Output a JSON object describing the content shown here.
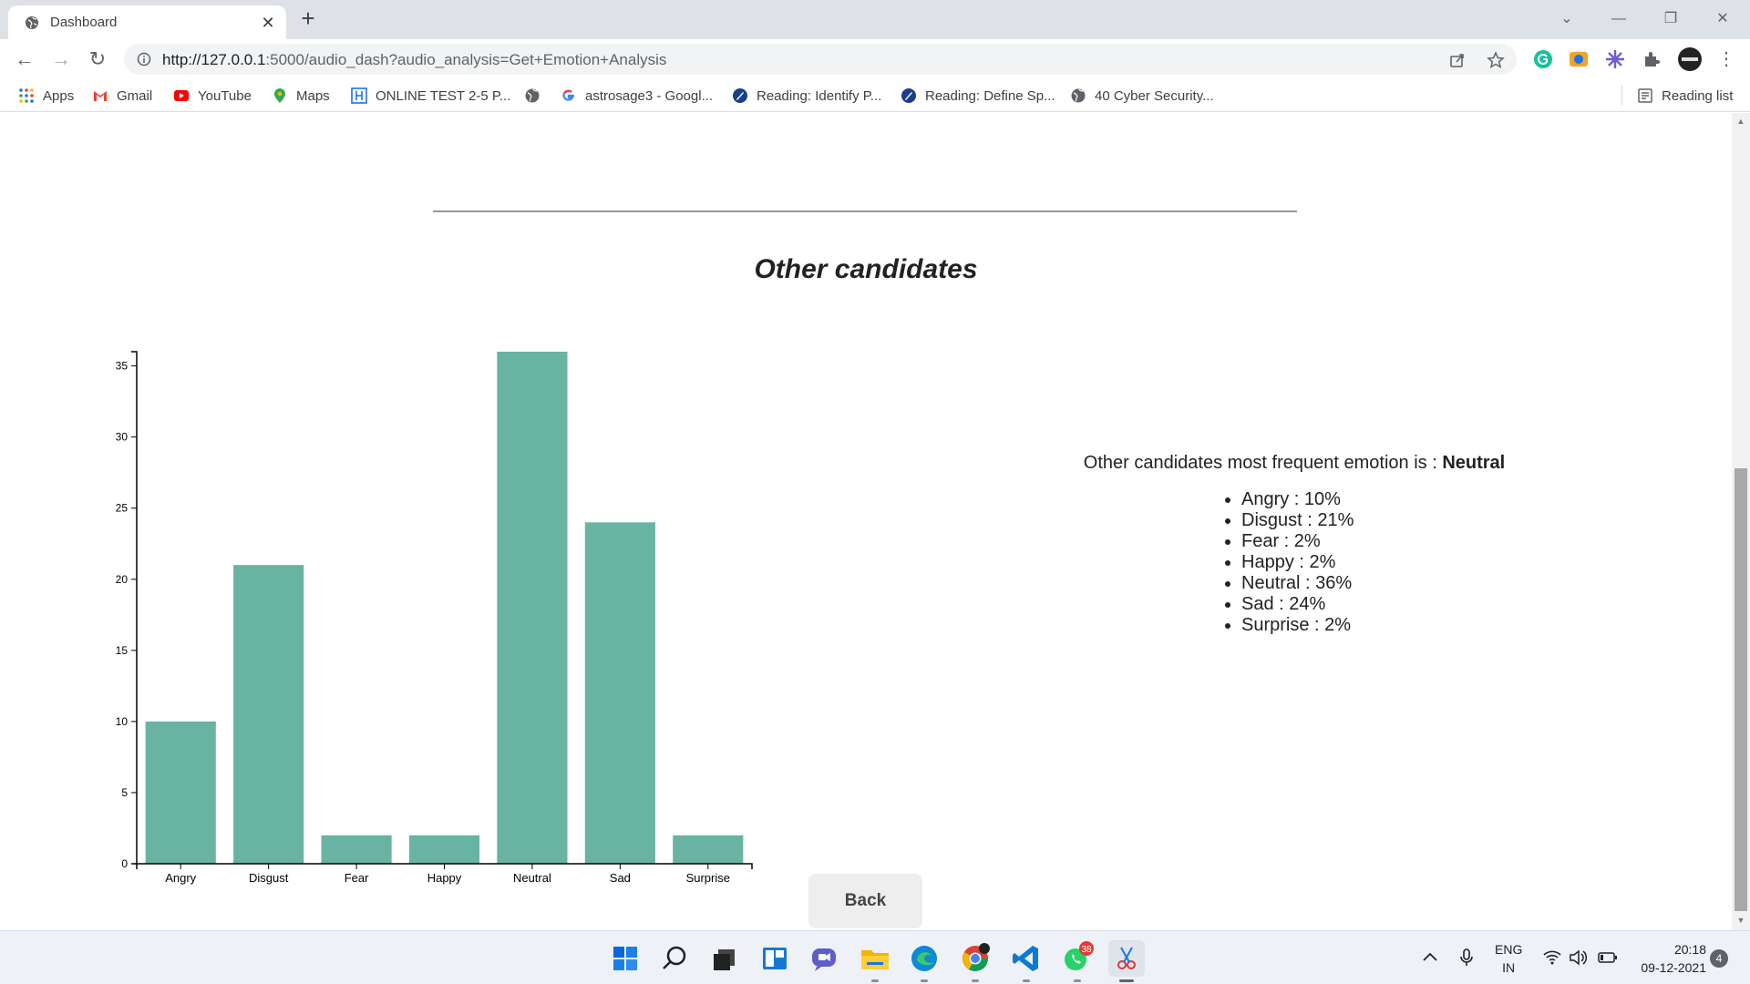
{
  "browser": {
    "tab": {
      "title": "Dashboard"
    },
    "url": {
      "host": "http://127.0.0.1",
      "rest": ":5000/audio_dash?audio_analysis=Get+Emotion+Analysis"
    },
    "bookmarks": [
      {
        "label": "Apps",
        "icon": "apps-grid-icon"
      },
      {
        "label": "Gmail",
        "icon": "gmail-icon"
      },
      {
        "label": "YouTube",
        "icon": "youtube-icon"
      },
      {
        "label": "Maps",
        "icon": "maps-icon"
      },
      {
        "label": "ONLINE TEST 2-5 P...",
        "icon": "hackerrank-icon"
      },
      {
        "label": "",
        "icon": "globe-icon"
      },
      {
        "label": "astrosage3 - Googl...",
        "icon": "google-icon"
      },
      {
        "label": "Reading: Identify P...",
        "icon": "rocket-icon"
      },
      {
        "label": "Reading: Define Sp...",
        "icon": "rocket-icon"
      },
      {
        "label": "40 Cyber Security...",
        "icon": "globe-icon"
      }
    ],
    "reading_list": "Reading list"
  },
  "page": {
    "section_title": "Other candidates",
    "summary_prefix": "Other candidates most frequent emotion is : ",
    "summary_emotion": "Neutral",
    "emotions": [
      "Angry : 10%",
      "Disgust : 21%",
      "Fear : 2%",
      "Happy : 2%",
      "Neutral : 36%",
      "Sad : 24%",
      "Surprise : 2%"
    ],
    "back_label": "Back"
  },
  "chart_data": {
    "type": "bar",
    "categories": [
      "Angry",
      "Disgust",
      "Fear",
      "Happy",
      "Neutral",
      "Sad",
      "Surprise"
    ],
    "values": [
      10,
      21,
      2,
      2,
      36,
      24,
      2
    ],
    "ylim": [
      0,
      36
    ],
    "yticks": [
      0,
      5,
      10,
      15,
      20,
      25,
      30,
      35
    ],
    "bar_color": "#69b3a2",
    "grid": false,
    "legend": "none",
    "title": "",
    "xlabel": "",
    "ylabel": ""
  },
  "taskbar": {
    "lang_line1": "ENG",
    "lang_line2": "IN",
    "time": "20:18",
    "date": "09-12-2021",
    "notification_count": "4",
    "whatsapp_badge": "38"
  }
}
